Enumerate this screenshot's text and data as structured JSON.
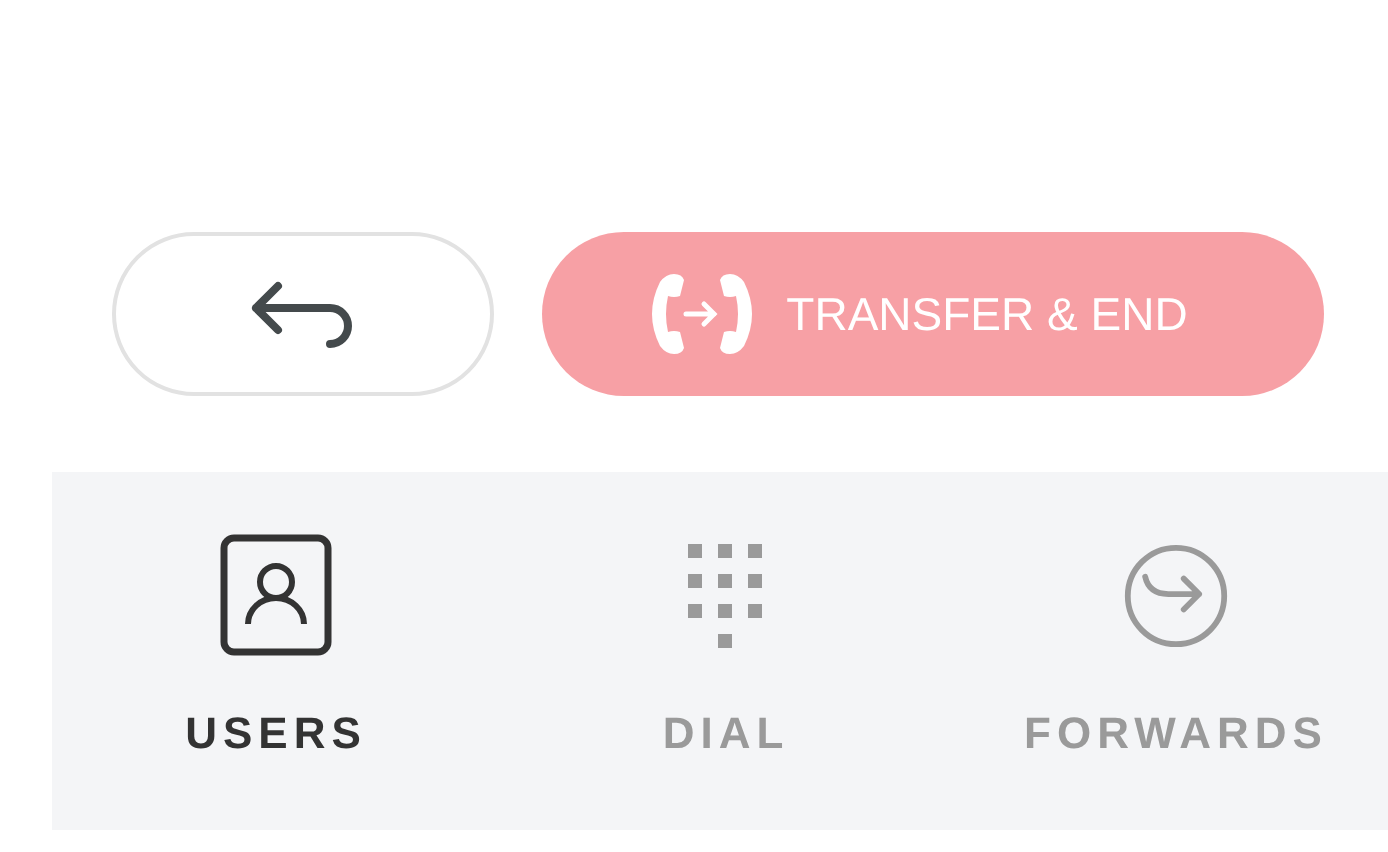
{
  "actions": {
    "back": {
      "kind": "back"
    },
    "transfer": {
      "label": "TRANSFER & END"
    }
  },
  "tabs": [
    {
      "kind": "users",
      "label": "USERS",
      "selected": true
    },
    {
      "kind": "dial",
      "label": "DIAL",
      "selected": false
    },
    {
      "kind": "forwards",
      "label": "FORWARDS",
      "selected": false
    }
  ]
}
